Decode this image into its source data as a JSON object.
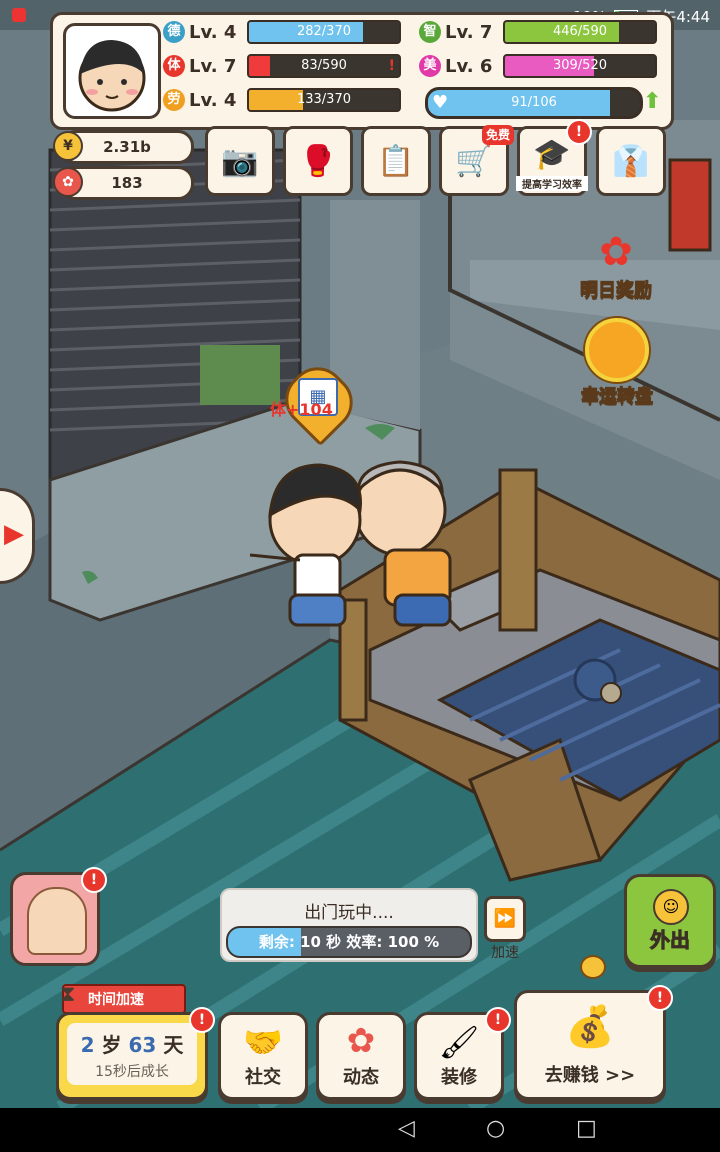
{
  "status_bar": {
    "battery": "19%",
    "time": "下午4:44"
  },
  "stats": [
    {
      "icon": "德",
      "level": "Lv. 4",
      "value": "282/370",
      "fraction": 0.76,
      "icon_color": "#3aa0c8",
      "bar_color": "#6fc3ee"
    },
    {
      "icon": "体",
      "level": "Lv. 7",
      "value": "83/590",
      "fraction": 0.14,
      "icon_color": "#e8362c",
      "bar_color": "#ef3b3b"
    },
    {
      "icon": "劳",
      "level": "Lv. 4",
      "value": "133/370",
      "fraction": 0.36,
      "icon_color": "#f0a020",
      "bar_color": "#f2b02c"
    },
    {
      "icon": "智",
      "level": "Lv. 7",
      "value": "446/590",
      "fraction": 0.76,
      "icon_color": "#5aa83a",
      "bar_color": "#8cc63f"
    },
    {
      "icon": "美",
      "level": "Lv. 6",
      "value": "309/520",
      "fraction": 0.59,
      "icon_color": "#e03aa8",
      "bar_color": "#e95bc1"
    }
  ],
  "love": {
    "value": "91/106",
    "fraction": 0.86
  },
  "currency": {
    "coins": "2.31b",
    "flowers": "183"
  },
  "top_buttons": [
    {
      "name": "camera-button",
      "icon": "📷"
    },
    {
      "name": "boxing-button",
      "icon": "🥊"
    },
    {
      "name": "notes-button",
      "icon": "📋"
    },
    {
      "name": "shop-button",
      "icon": "🛒",
      "badge": "免费"
    },
    {
      "name": "study-efficiency-button",
      "icon": "🎓",
      "label": "提高学习效率"
    },
    {
      "name": "wardrobe-button",
      "icon": "👔"
    }
  ],
  "side_features": {
    "tomorrow_reward": "明日奖励",
    "lucky_wheel": "幸运转盘"
  },
  "bubble": {
    "stat": "体",
    "value": "+104"
  },
  "activity": {
    "title": "出门玩中....",
    "remaining": "剩余: 10 秒  效率: 100 %",
    "speed_label": "加速"
  },
  "go_out": "外出",
  "time_boost": "时间加速",
  "age": {
    "years": "2",
    "years_unit": "岁",
    "days": "63",
    "days_unit": "天",
    "next": "15秒后成长"
  },
  "bottom_buttons": [
    {
      "name": "social-button",
      "label": "社交",
      "icon": "🤝"
    },
    {
      "name": "moments-button",
      "label": "动态",
      "icon": "✿"
    },
    {
      "name": "decorate-button",
      "label": "装修",
      "icon": "🖌"
    },
    {
      "name": "earn-money-button",
      "label": "去赚钱 >>",
      "icon": "💰"
    }
  ],
  "nav": {
    "back": "◁",
    "home": "○",
    "recent": "□"
  }
}
